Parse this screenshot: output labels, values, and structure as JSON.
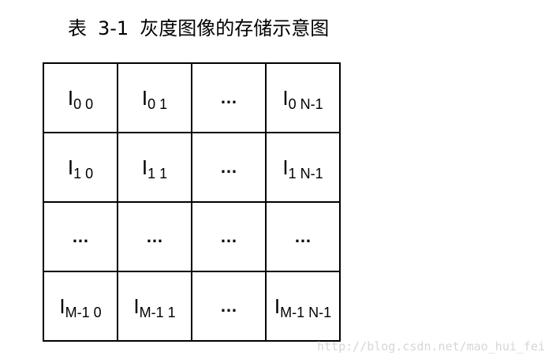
{
  "caption": {
    "label": "表",
    "number": "3-1",
    "text": "灰度图像的存储示意图"
  },
  "table": {
    "rows": [
      [
        {
          "base": "I",
          "sub": "0 0"
        },
        {
          "base": "I",
          "sub": "0 1"
        },
        {
          "text": "…"
        },
        {
          "base": "I",
          "sub": "0 N-1"
        }
      ],
      [
        {
          "base": "I",
          "sub": "1 0"
        },
        {
          "base": "I",
          "sub": "1 1"
        },
        {
          "text": "…"
        },
        {
          "base": "I",
          "sub": "1 N-1"
        }
      ],
      [
        {
          "text": "…"
        },
        {
          "text": "…"
        },
        {
          "text": "…"
        },
        {
          "text": "…"
        }
      ],
      [
        {
          "base": "I",
          "sub": "M-1 0"
        },
        {
          "base": "I",
          "sub": "M-1 1"
        },
        {
          "text": "…"
        },
        {
          "base": "I",
          "sub": "M-1 N-1"
        }
      ]
    ]
  },
  "watermark": "http://blog.csdn.net/mao_hui_fei"
}
